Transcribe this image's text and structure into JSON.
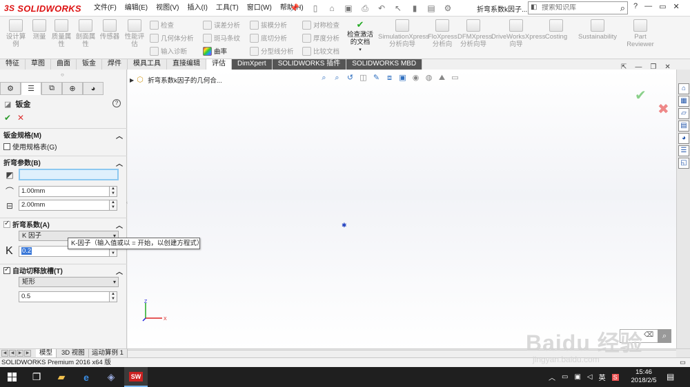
{
  "app": {
    "logo_ds": "3S",
    "logo_text": "SOLIDWORKS",
    "doc_title": "折弯系数k因子...",
    "kb_search_placeholder": "搜索知识库"
  },
  "menu": [
    "文件(F)",
    "编辑(E)",
    "视图(V)",
    "插入(I)",
    "工具(T)",
    "窗口(W)",
    "帮助(H)"
  ],
  "window_controls": [
    "?",
    "—",
    "▭",
    "✕"
  ],
  "command_manager": {
    "big_tools": [
      {
        "label": "设计算例",
        "sub": ""
      },
      {
        "label": "测量",
        "sub": ""
      },
      {
        "label": "质量属",
        "sub": "性"
      },
      {
        "label": "剖面属",
        "sub": "性"
      },
      {
        "label": "传感器",
        "sub": ""
      },
      {
        "label": "性能评",
        "sub": "估"
      }
    ],
    "small_tools": [
      {
        "label": "检查",
        "active": false
      },
      {
        "label": "几何体分析",
        "active": false
      },
      {
        "label": "输入诊断",
        "active": false
      },
      {
        "label": "误差分析",
        "active": false
      },
      {
        "label": "斑马条纹",
        "active": false
      },
      {
        "label": "曲率",
        "active": true
      },
      {
        "label": "拔模分析",
        "active": false
      },
      {
        "label": "底切分析",
        "active": false
      },
      {
        "label": "分型线分析",
        "active": false
      },
      {
        "label": "对称检查",
        "active": false
      },
      {
        "label": "厚度分析",
        "active": false
      },
      {
        "label": "比较文档",
        "active": false
      }
    ],
    "check_active": {
      "line1": "检查激活",
      "line2": "的文档"
    },
    "addins": [
      {
        "line1": "SimulationXpress",
        "line2": "分析向导"
      },
      {
        "line1": "FloXpress",
        "line2": "分析向"
      },
      {
        "line1": "DFMXpress",
        "line2": "分析向导"
      },
      {
        "line1": "DriveWorksXpress",
        "line2": "向导"
      },
      {
        "line1": "Costing",
        "line2": ""
      },
      {
        "line1": "Sustainability",
        "line2": ""
      },
      {
        "line1": "Part",
        "line2": "Reviewer"
      }
    ]
  },
  "command_tabs": [
    "特征",
    "草图",
    "曲面",
    "钣金",
    "焊件",
    "模具工具",
    "直接编辑",
    "评估",
    "DimXpert",
    "SOLIDWORKS 插件",
    "SOLIDWORKS MBD"
  ],
  "property_manager": {
    "title": "钣金",
    "gauge_group": {
      "title": "钣金规格(M)",
      "use_gauge_label": "使用规格表(G)",
      "use_gauge_checked": false
    },
    "bend_params": {
      "title": "折弯参数(B)",
      "thickness": "1.00mm",
      "radius": "2.00mm",
      "face_value": ""
    },
    "bend_allowance": {
      "title": "折弯系数(A)",
      "type": "K 因子",
      "k_label": "K",
      "k_value": "0.2"
    },
    "relief": {
      "title": "自动切释放槽(T)",
      "checked": true,
      "type": "矩形",
      "ratio": "0.5"
    }
  },
  "tooltip": "K-因子（输入值或以 = 开始，以创建方程式）",
  "graphics": {
    "tree_label": "折弯系数k因子的几何合..."
  },
  "bottom_tabs": [
    "模型",
    "3D 视图",
    "运动算例 1"
  ],
  "status_text": "SOLIDWORKS Premium 2016 x64 版",
  "taskbar": {
    "ime": "英",
    "time": "15:46",
    "date": "2018/2/5"
  },
  "watermark": {
    "text": "Baidu 经验",
    "url": "jingyan.baidu.com"
  }
}
